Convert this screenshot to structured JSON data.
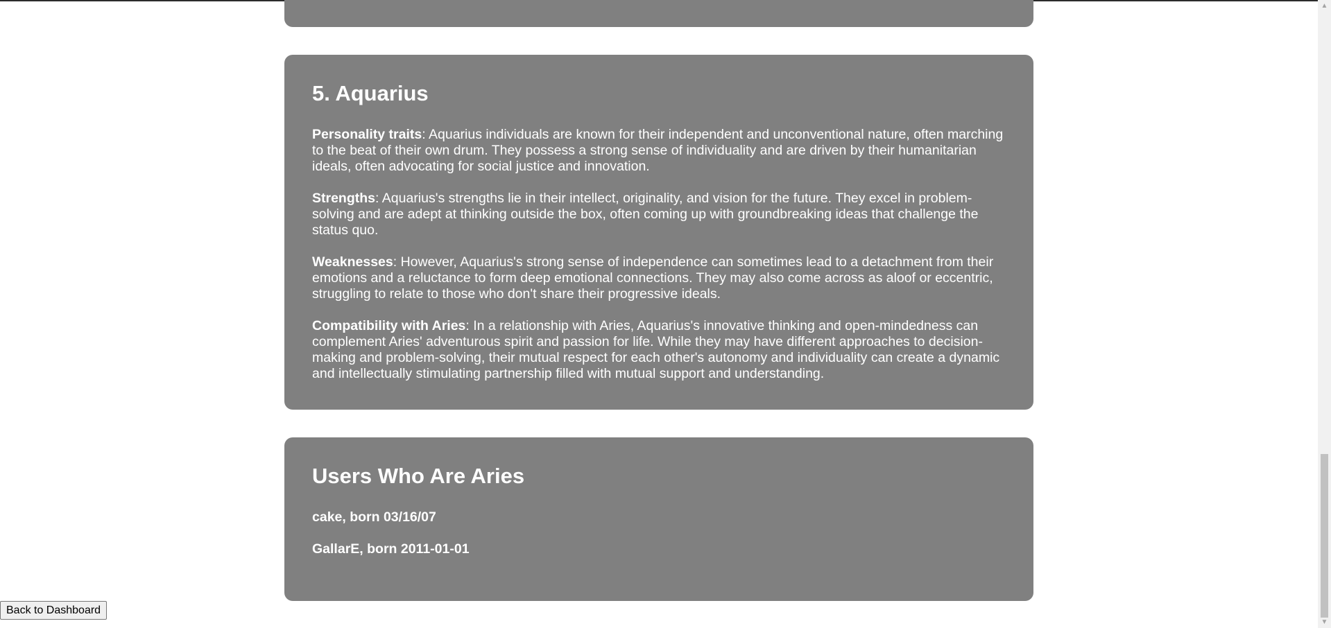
{
  "aquarius": {
    "title": "5. Aquarius",
    "sections": [
      {
        "label": "Personality traits",
        "text": ": Aquarius individuals are known for their independent and unconventional nature, often marching to the beat of their own drum. They possess a strong sense of individuality and are driven by their humanitarian ideals, often advocating for social justice and innovation."
      },
      {
        "label": "Strengths",
        "text": ": Aquarius's strengths lie in their intellect, originality, and vision for the future. They excel in problem-solving and are adept at thinking outside the box, often coming up with groundbreaking ideas that challenge the status quo."
      },
      {
        "label": "Weaknesses",
        "text": ": However, Aquarius's strong sense of independence can sometimes lead to a detachment from their emotions and a reluctance to form deep emotional connections. They may also come across as aloof or eccentric, struggling to relate to those who don't share their progressive ideals."
      },
      {
        "label": "Compatibility with Aries",
        "text": ": In a relationship with Aries, Aquarius's innovative thinking and open-mindedness can complement Aries' adventurous spirit and passion for life. While they may have different approaches to decision-making and problem-solving, their mutual respect for each other's autonomy and individuality can create a dynamic and intellectually stimulating partnership filled with mutual support and understanding."
      }
    ]
  },
  "users": {
    "title": "Users Who Are Aries",
    "list": [
      "cake, born 03/16/07",
      "GallarE, born 2011-01-01"
    ]
  },
  "back_button": {
    "label": "Back to Dashboard"
  },
  "colors": {
    "card_bg": "#808080",
    "text": "#ffffff"
  },
  "icons": {
    "scroll_up": "scroll-up-arrow-icon",
    "scroll_down": "scroll-down-arrow-icon"
  }
}
